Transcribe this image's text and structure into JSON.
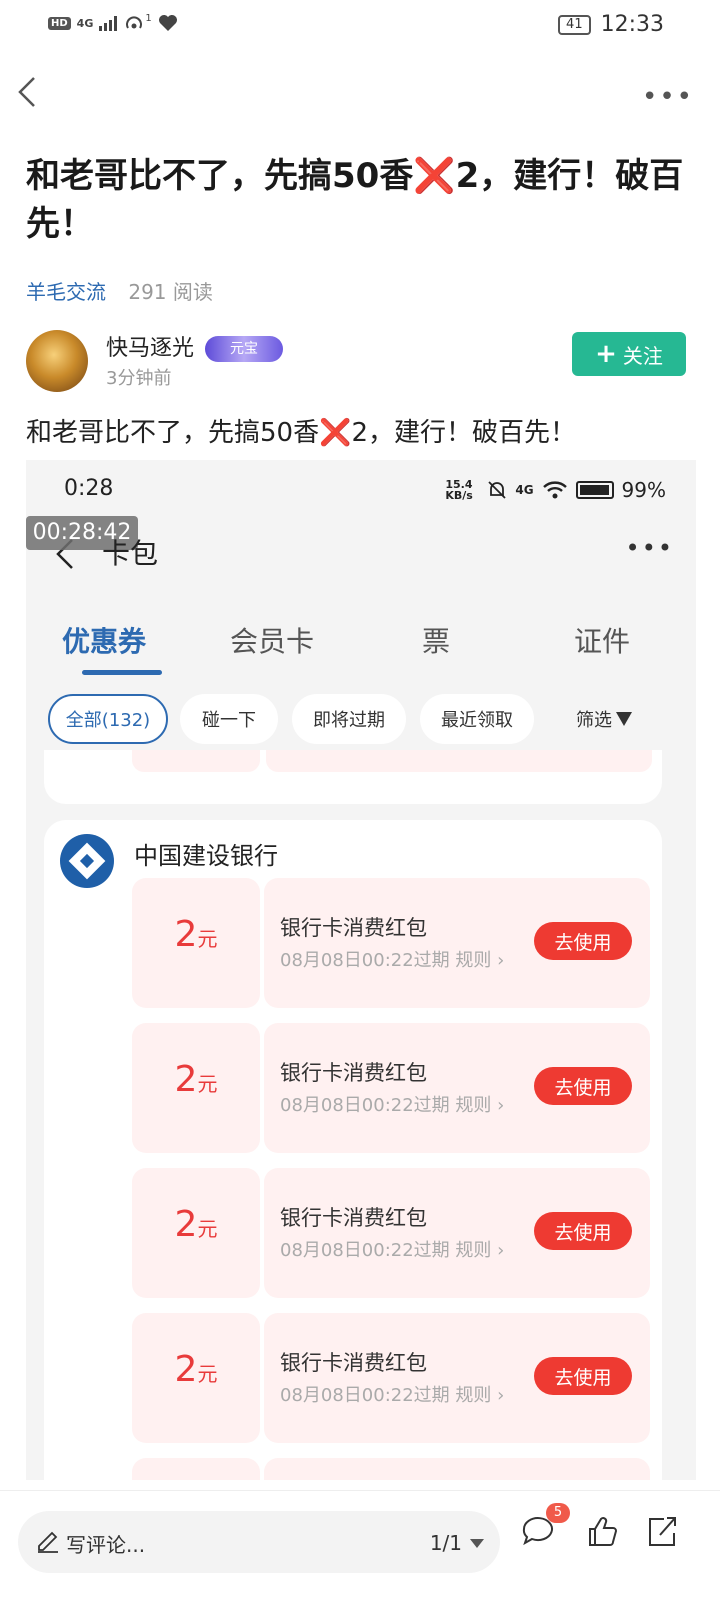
{
  "status_bar": {
    "hd": "HD",
    "network": "4G",
    "hotspot_count": "1",
    "battery": "41",
    "time": "12:33"
  },
  "post": {
    "title": "和老哥比不了，先搞50香❌2，建行！破百先！",
    "category": "羊毛交流",
    "reads": "291 阅读",
    "author": {
      "name": "快马逐光",
      "badge": "元宝",
      "time": "3分钟前"
    },
    "follow_label": "关注",
    "body": "和老哥比不了，先搞50香❌2，建行！破百先！"
  },
  "screenshot": {
    "status": {
      "time": "0:28",
      "speed": "15.4 KB/s",
      "network": "4G",
      "battery": "99%"
    },
    "timer": "00:28:42",
    "title": "卡包",
    "tabs": [
      "优惠券",
      "会员卡",
      "票",
      "证件"
    ],
    "active_tab": "优惠券",
    "filters": [
      "全部(132)",
      "碰一下",
      "即将过期",
      "最近领取",
      "筛选"
    ],
    "bank": "中国建设银行",
    "coupons": [
      {
        "amount": "2",
        "unit": "元",
        "name": "银行卡消费红包",
        "expiry": "08月08日00:22过期",
        "rule": "规则 ›",
        "action": "去使用"
      },
      {
        "amount": "2",
        "unit": "元",
        "name": "银行卡消费红包",
        "expiry": "08月08日00:22过期",
        "rule": "规则 ›",
        "action": "去使用"
      },
      {
        "amount": "2",
        "unit": "元",
        "name": "银行卡消费红包",
        "expiry": "08月08日00:22过期",
        "rule": "规则 ›",
        "action": "去使用"
      },
      {
        "amount": "2",
        "unit": "元",
        "name": "银行卡消费红包",
        "expiry": "08月08日00:22过期",
        "rule": "规则 ›",
        "action": "去使用"
      }
    ]
  },
  "bottom_bar": {
    "compose_placeholder": "写评论...",
    "pager": "1/1",
    "comment_count": "5"
  },
  "colors": {
    "accent_blue": "#2d6ab1",
    "follow_green": "#26b893",
    "coupon_red": "#ee3a32",
    "coupon_bg": "#fff1f1"
  }
}
